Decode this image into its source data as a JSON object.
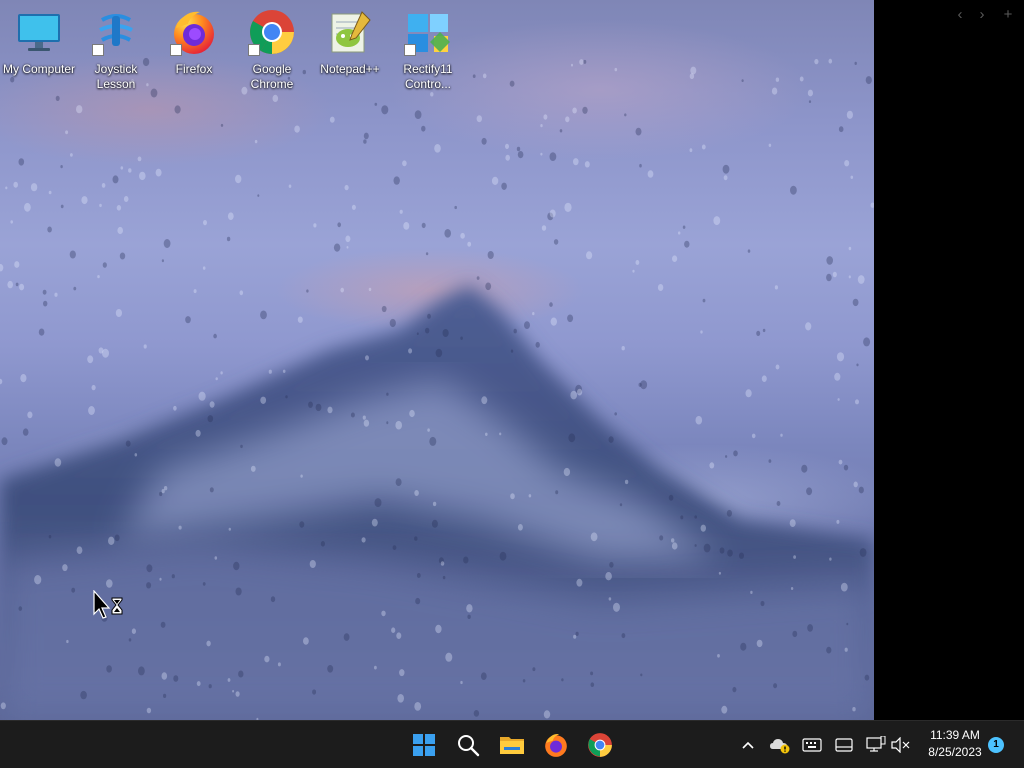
{
  "desktop": {
    "icons": [
      {
        "label": "My Computer",
        "icon": "monitor-icon",
        "shortcut": false
      },
      {
        "label": "Joystick\nLesson",
        "icon": "joystick-lesson-icon",
        "shortcut": true
      },
      {
        "label": "Firefox",
        "icon": "firefox-icon",
        "shortcut": true
      },
      {
        "label": "Google\nChrome",
        "icon": "chrome-icon",
        "shortcut": true
      },
      {
        "label": "Notepad++",
        "icon": "notepadpp-icon",
        "shortcut": false
      },
      {
        "label": "Rectify11\nContro...",
        "icon": "control-panel-icon",
        "shortcut": true
      }
    ]
  },
  "side_panel": {
    "prev": "‹",
    "next": "›",
    "add": "+"
  },
  "taskbar": {
    "pinned": [
      "start-icon",
      "search-icon",
      "file-explorer-icon",
      "firefox-icon",
      "chrome-icon"
    ],
    "tray": {
      "chevron": "^",
      "icons": [
        "onedrive-icon",
        "keyboard-icon",
        "tablet-icon",
        "network-icon",
        "volume-muted-icon"
      ]
    },
    "clock": {
      "time": "11:39 AM",
      "date": "8/25/2023"
    },
    "notification_count": "1"
  },
  "colors": {
    "taskbar_bg": "#1c1c1c",
    "accent": "#4cc2ff",
    "start_blue": "#3aa0f0"
  }
}
